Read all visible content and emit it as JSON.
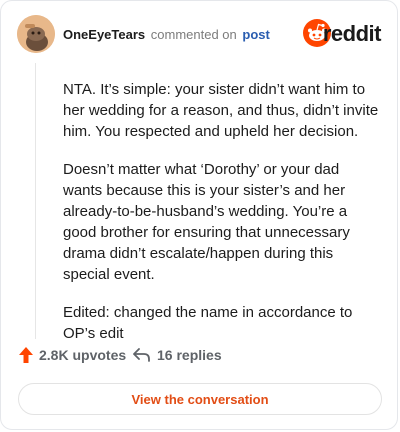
{
  "header": {
    "username": "OneEyeTears",
    "verb": "commented on",
    "post_link": "post",
    "brand_word": "reddit",
    "brand_color": "#ff4500"
  },
  "comment": {
    "paragraphs": [
      "NTA. It’s simple: your sister didn’t want him to her wedding for a reason, and thus, didn’t invite him. You respected and upheld her decision.",
      "Doesn’t matter what ‘Dorothy’ or your dad wants because this is your sister’s and her already-to-be-husband’s wedding. You’re a good brother for ensuring that unnecessary drama didn’t escalate/happen during this special event.",
      "Edited: changed the name in accordance to OP’s edit"
    ]
  },
  "actions": {
    "upvotes": "2.8K upvotes",
    "replies": "16 replies",
    "upvote_icon": "upvote-arrow-icon",
    "reply_icon": "reply-arrow-icon",
    "upvote_color": "#ff4500"
  },
  "cta": {
    "label": "View the conversation",
    "color": "#e24d15"
  }
}
